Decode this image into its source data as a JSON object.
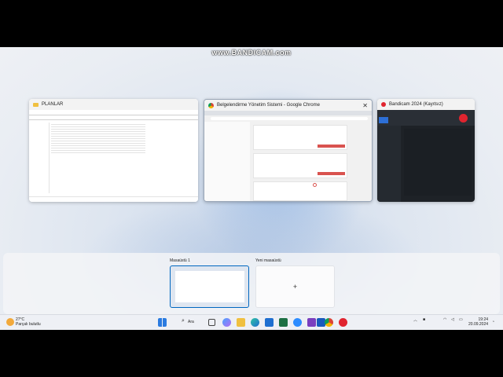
{
  "watermark": "www.BANDICAM.com",
  "windows": {
    "explorer": {
      "title": "PLANLAR"
    },
    "chrome": {
      "title": "Belgelendirme Yönetim Sistemi - Google Chrome",
      "close_glyph": "✕"
    },
    "bandicam": {
      "title": "Bandicam 2024 (Kayıtsız)"
    }
  },
  "virtual_desktops": {
    "desktop1_label": "Masaüstü 1",
    "new_label": "Yeni masaüstü",
    "new_plus": "+"
  },
  "taskbar": {
    "weather_temp": "27°C",
    "weather_desc": "Parçalı bulutlu",
    "search_label": "Ara",
    "time": "19:24",
    "date": "20.09.2024"
  },
  "colors": {
    "accent": "#0067c0",
    "chrome_red": "#d9534f",
    "bandicam_red": "#e0242f"
  }
}
